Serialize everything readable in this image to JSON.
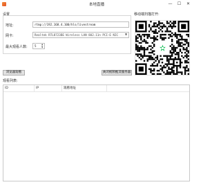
{
  "window": {
    "title": "本地直播",
    "min_glyph": "—",
    "max_glyph": "☐",
    "close_glyph": "✕"
  },
  "settings": {
    "section_label": "设置",
    "url_label": "地址:",
    "url_value": "rtmp://192.168.4.100/hls/livestream",
    "nic_label": "网卡:",
    "nic_value": "Realtek RTL8723BE Wireless LAN 802.11n PCI-E NIC",
    "max_viewers_label": "最大观看人数:",
    "max_viewers_value": "5"
  },
  "qr": {
    "label": "移动端扫描打开:"
  },
  "buttons": {
    "browser_watch": "浏览器观看",
    "stop_server": "关闭视频推流服务器"
  },
  "viewers": {
    "label": "观看列表:",
    "columns": [
      "ID",
      "IP",
      "观看地址"
    ]
  },
  "colors": {
    "qr_logo_green": "#19c05c",
    "app_icon": "#e4532a"
  }
}
